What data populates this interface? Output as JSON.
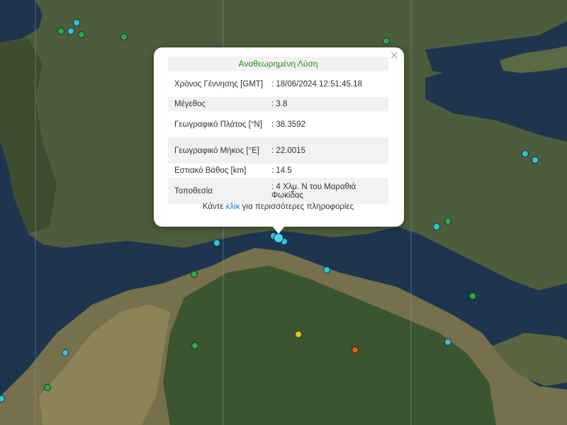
{
  "map": {
    "background_colors": {
      "sea": "#1e3550",
      "land": "#4a5a3a",
      "peloponnese": "#7a7050",
      "forest": "#2f4a28"
    },
    "marker_colors": {
      "green": "#2ea84a",
      "cyan": "#33c3d9",
      "yellow": "#e0c52a",
      "orange": "#e0591e",
      "selected": "#46d6ef"
    }
  },
  "popup": {
    "title": "Αναθεωρημένη Λύση",
    "close_symbol": "×",
    "rows": [
      {
        "label": "Χρόνος Γέννησης [GMT]",
        "value": ": 18/06/2024 12:51:45.18"
      },
      {
        "label": "Μέγεθος",
        "value": ": 3.8"
      },
      {
        "label": "Γεωγραφικό Πλάτος [°N]",
        "value": ": 38.3592"
      },
      {
        "label": "Γεωγραφικό Μήκος [°E]",
        "value": ": 22.0015"
      },
      {
        "label": "Εστιακό Βάθος [km]",
        "value": ": 14.5"
      },
      {
        "label": "Τοποθεσία",
        "value": ": 4 Χλμ. Ν του Μαραθιά Φωκίδας"
      }
    ],
    "more_prefix": "Κάντε ",
    "more_link": "κλικ",
    "more_suffix": " για περισσότερες πληροφορίες"
  }
}
